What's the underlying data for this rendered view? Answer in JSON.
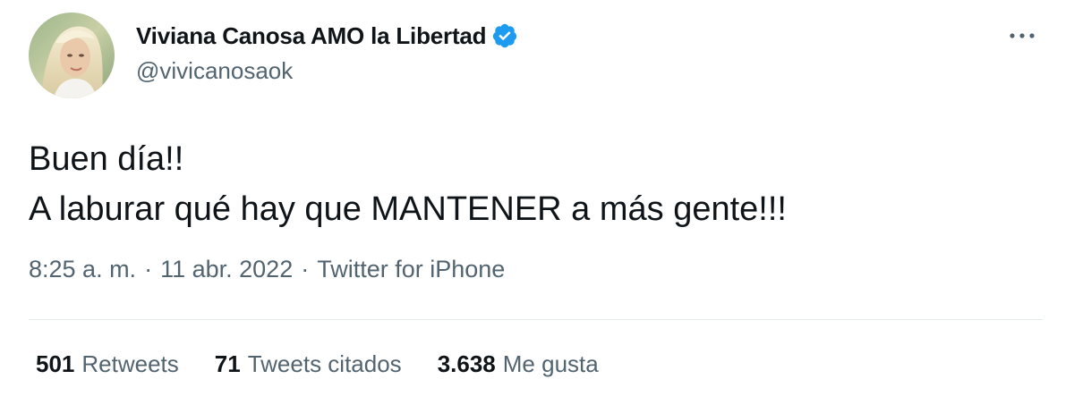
{
  "user": {
    "display_name": "Viviana Canosa AMO la Libertad",
    "handle": "@vivicanosaok",
    "verified": true
  },
  "tweet": {
    "lines": [
      "Buen día!!",
      "A laburar qué hay que MANTENER a más gente!!!"
    ],
    "time": "8:25 a. m.",
    "date": "11 abr. 2022",
    "source": "Twitter for iPhone",
    "separator": "·"
  },
  "stats": {
    "retweets": {
      "count": "501",
      "label": "Retweets"
    },
    "quotes": {
      "count": "71",
      "label": "Tweets citados"
    },
    "likes": {
      "count": "3.638",
      "label": "Me gusta"
    }
  },
  "icons": {
    "verified": "verified-badge-icon",
    "more": "more-horizontal-icon"
  },
  "colors": {
    "text_primary": "#0f1419",
    "text_secondary": "#536471",
    "verified_blue": "#1d9bf0",
    "divider": "#e4e9ec"
  }
}
